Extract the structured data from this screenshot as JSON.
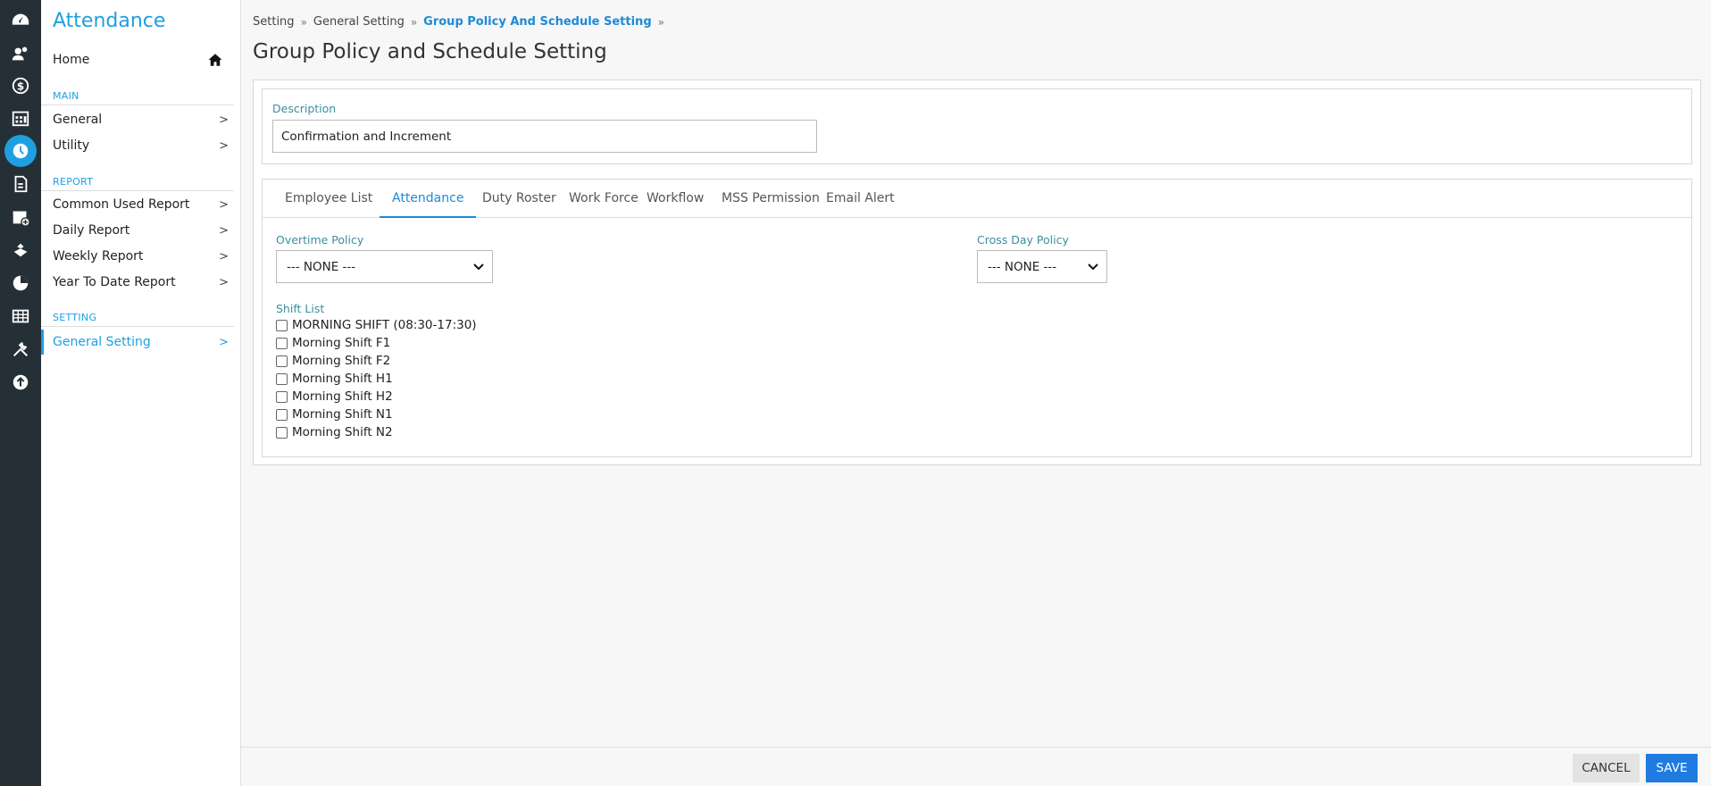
{
  "app_title": "Attendance",
  "rail_icons": [
    "dashboard-icon",
    "user-group-icon",
    "dollar-icon",
    "calendar-building-icon",
    "clock-icon",
    "document-icon",
    "calendar-add-icon",
    "hands-icon",
    "pie-chart-icon",
    "table-icon",
    "tools-icon",
    "upload-icon"
  ],
  "sidebar": {
    "home": "Home",
    "main_label": "MAIN",
    "main_items": [
      "General",
      "Utility"
    ],
    "report_label": "REPORT",
    "report_items": [
      "Common Used Report",
      "Daily Report",
      "Weekly Report",
      "Year To Date Report"
    ],
    "setting_label": "SETTING",
    "setting_items": [
      "General Setting"
    ],
    "chevron": ">"
  },
  "breadcrumb": {
    "items": [
      "Setting",
      "General Setting",
      "Group Policy And Schedule Setting"
    ],
    "separator": "»"
  },
  "page_title": "Group Policy and Schedule Setting",
  "description": {
    "label": "Description",
    "value": "Confirmation and Increment"
  },
  "tabs": [
    "Employee List",
    "Attendance",
    "Duty Roster",
    "Work Force",
    "Workflow",
    "MSS Permission",
    "Email Alert"
  ],
  "active_tab": "Attendance",
  "overtime_policy": {
    "label": "Overtime Policy",
    "value": "--- NONE ---"
  },
  "cross_day_policy": {
    "label": "Cross Day Policy",
    "value": "--- NONE ---"
  },
  "shift_list": {
    "label": "Shift List",
    "items": [
      "MORNING SHIFT (08:30-17:30)",
      "Morning Shift F1",
      "Morning Shift F2",
      "Morning Shift H1",
      "Morning Shift H2",
      "Morning Shift N1",
      "Morning Shift N2"
    ]
  },
  "footer": {
    "cancel": "CANCEL",
    "save": "SAVE"
  },
  "colors": {
    "accent": "#1e9fe0",
    "rail_bg": "#253036",
    "save_bg": "#1f7be0",
    "label_teal": "#3a8f9e"
  }
}
